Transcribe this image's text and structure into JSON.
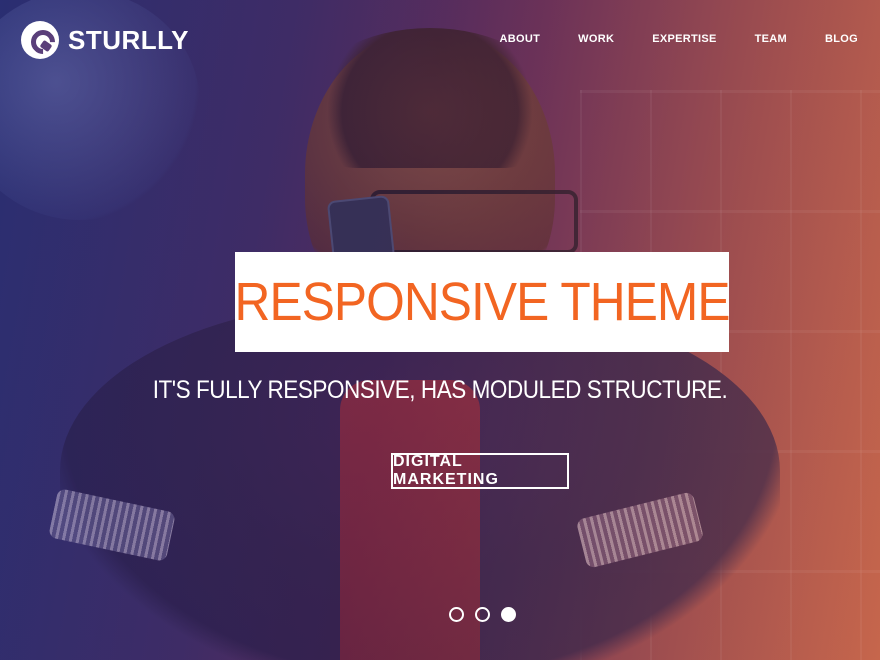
{
  "brand": {
    "name": "STURLLY"
  },
  "nav": {
    "items": [
      {
        "label": "ABOUT"
      },
      {
        "label": "WORK"
      },
      {
        "label": "EXPERTISE"
      },
      {
        "label": "TEAM"
      },
      {
        "label": "BLOG"
      }
    ]
  },
  "hero": {
    "title": "RESPONSIVE THEME",
    "subtitle": "IT'S FULLY RESPONSIVE, HAS MODULED STRUCTURE.",
    "button_label": "DIGITAL MARKETING",
    "slides": {
      "count": 3,
      "active_index": 2
    }
  },
  "colors": {
    "accent": "#f26522",
    "text_light": "#ffffff"
  }
}
